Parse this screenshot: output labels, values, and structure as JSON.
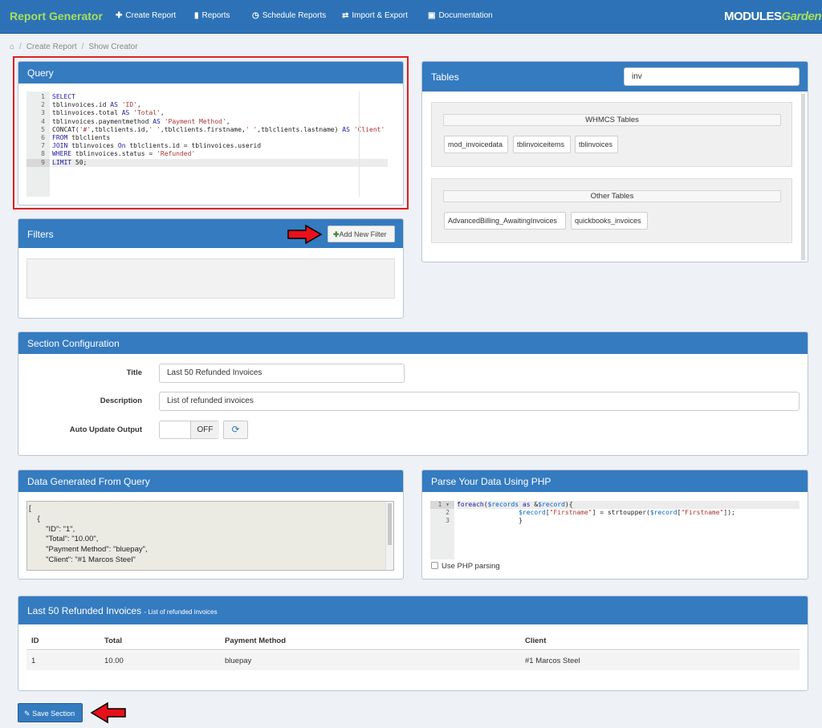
{
  "nav": {
    "brand": "Report Generator",
    "items": [
      {
        "label": "Create Report",
        "icon": "plus-icon"
      },
      {
        "label": "Reports",
        "icon": "bar-chart-icon"
      },
      {
        "label": "Schedule Reports",
        "icon": "clock-icon"
      },
      {
        "label": "Import & Export",
        "icon": "exchange-icon"
      },
      {
        "label": "Documentation",
        "icon": "book-icon"
      }
    ],
    "logo_main": "MODULES",
    "logo_accent": "Garden"
  },
  "breadcrumb": [
    "Create Report",
    "Show Creator"
  ],
  "query": {
    "title": "Query",
    "lines": [
      "SELECT",
      "tblinvoices.id AS 'ID',",
      "tblinvoices.total AS 'Total',",
      "tblinvoices.paymentmethod AS 'Payment Method',",
      "CONCAT('#',tblclients.id,' ',tblclients.firstname,' ',tblclients.lastname) AS 'Client'",
      "FROM tblclients",
      "JOIN tblinvoices On tblclients.id = tblinvoices.userid",
      "WHERE tblinvoices.status = 'Refunded'",
      "LIMIT 50;"
    ]
  },
  "tables": {
    "title": "Tables",
    "search_value": "inv",
    "whmcs_title": "WHMCS Tables",
    "whmcs": [
      "mod_invoicedata",
      "tblinvoiceitems",
      "tblinvoices"
    ],
    "other_title": "Other Tables",
    "other": [
      "AdvancedBilling_AwaitingInvoices",
      "quickbooks_invoices"
    ]
  },
  "filters": {
    "title": "Filters",
    "add_label": "Add New Filter"
  },
  "section_config": {
    "title": "Section Configuration",
    "title_label": "Title",
    "title_value": "Last 50 Refunded Invoices",
    "description_label": "Description",
    "description_value": "List of refunded invoices",
    "auto_update_label": "Auto Update Output",
    "toggle_state": "OFF"
  },
  "data_generated": {
    "title": "Data Generated From Query",
    "lines": [
      "[",
      "    {",
      "        \"ID\": \"1\",",
      "        \"Total\": \"10.00\",",
      "        \"Payment Method\": \"bluepay\",",
      "        \"Client\": \"#1 Marcos Steel\""
    ]
  },
  "php": {
    "title": "Parse Your Data Using PHP",
    "lines": [
      "foreach($records as &$record){",
      "                $record[\"Firstname\"] = strtoupper($record[\"Firstname\"]);",
      "                }"
    ],
    "use_label": "Use PHP parsing"
  },
  "results": {
    "title": "Last 50 Refunded Invoices",
    "subtitle": "- List of refunded invoices",
    "columns": [
      "ID",
      "Total",
      "Payment Method",
      "Client"
    ],
    "rows": [
      [
        "1",
        "10.00",
        "bluepay",
        "#1 Marcos Steel"
      ]
    ]
  },
  "save_label": "Save Section",
  "colors": {
    "header": "#357bc0",
    "nav": "#2d72b6",
    "brand": "#a6e05a",
    "arrow": "#e8101b",
    "highlight_border": "#e02020"
  }
}
